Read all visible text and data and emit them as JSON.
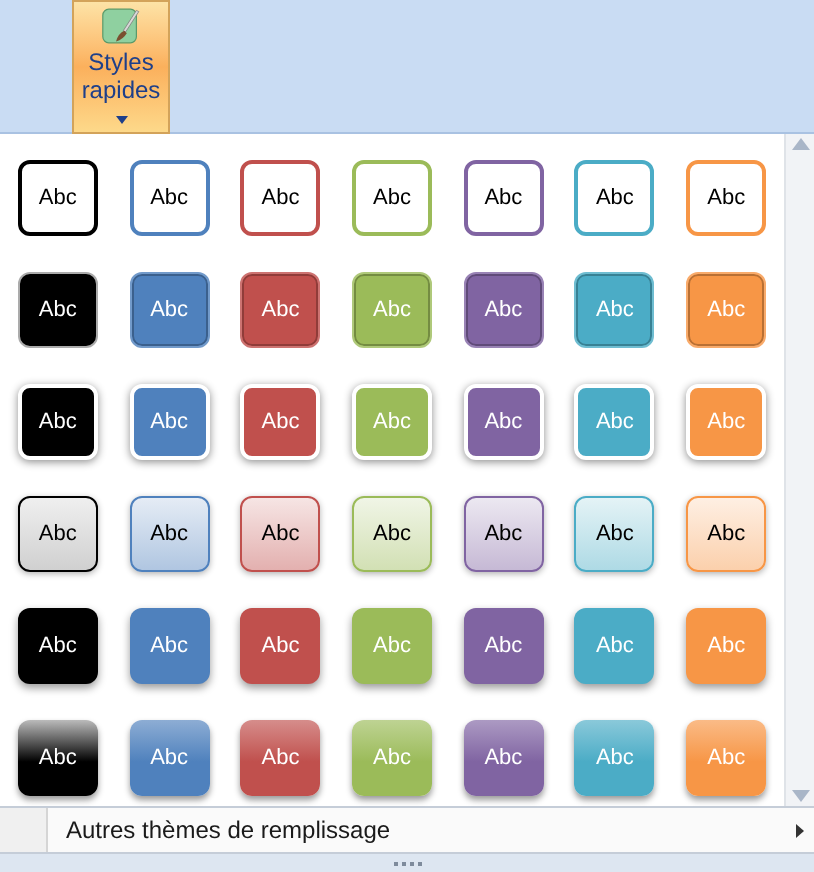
{
  "ribbon_button": {
    "label": "Styles rapides",
    "pressed": true
  },
  "gallery": {
    "rows": [
      {
        "kind": "outline",
        "items": [
          {
            "text": "Abc",
            "color": "#000000"
          },
          {
            "text": "Abc",
            "color": "#4f81bd"
          },
          {
            "text": "Abc",
            "color": "#c0504d"
          },
          {
            "text": "Abc",
            "color": "#9bbb59"
          },
          {
            "text": "Abc",
            "color": "#8064a2"
          },
          {
            "text": "Abc",
            "color": "#4bacc6"
          },
          {
            "text": "Abc",
            "color": "#f79646"
          }
        ]
      },
      {
        "kind": "solid",
        "items": [
          {
            "text": "Abc",
            "color": "#000000"
          },
          {
            "text": "Abc",
            "color": "#4f81bd"
          },
          {
            "text": "Abc",
            "color": "#c0504d"
          },
          {
            "text": "Abc",
            "color": "#9bbb59"
          },
          {
            "text": "Abc",
            "color": "#8064a2"
          },
          {
            "text": "Abc",
            "color": "#4bacc6"
          },
          {
            "text": "Abc",
            "color": "#f79646"
          }
        ]
      },
      {
        "kind": "framed",
        "items": [
          {
            "text": "Abc",
            "color": "#000000"
          },
          {
            "text": "Abc",
            "color": "#4f81bd"
          },
          {
            "text": "Abc",
            "color": "#c0504d"
          },
          {
            "text": "Abc",
            "color": "#9bbb59"
          },
          {
            "text": "Abc",
            "color": "#8064a2"
          },
          {
            "text": "Abc",
            "color": "#4bacc6"
          },
          {
            "text": "Abc",
            "color": "#f79646"
          }
        ]
      },
      {
        "kind": "pale",
        "items": [
          {
            "text": "Abc",
            "color": "#000000"
          },
          {
            "text": "Abc",
            "color": "#4f81bd"
          },
          {
            "text": "Abc",
            "color": "#c0504d"
          },
          {
            "text": "Abc",
            "color": "#9bbb59"
          },
          {
            "text": "Abc",
            "color": "#8064a2"
          },
          {
            "text": "Abc",
            "color": "#4bacc6"
          },
          {
            "text": "Abc",
            "color": "#f79646"
          }
        ]
      },
      {
        "kind": "intense",
        "items": [
          {
            "text": "Abc",
            "color": "#000000"
          },
          {
            "text": "Abc",
            "color": "#4f81bd"
          },
          {
            "text": "Abc",
            "color": "#c0504d"
          },
          {
            "text": "Abc",
            "color": "#9bbb59"
          },
          {
            "text": "Abc",
            "color": "#8064a2"
          },
          {
            "text": "Abc",
            "color": "#4bacc6"
          },
          {
            "text": "Abc",
            "color": "#f79646"
          }
        ]
      },
      {
        "kind": "glossy",
        "items": [
          {
            "text": "Abc",
            "color": "#000000"
          },
          {
            "text": "Abc",
            "color": "#4f81bd"
          },
          {
            "text": "Abc",
            "color": "#c0504d"
          },
          {
            "text": "Abc",
            "color": "#9bbb59"
          },
          {
            "text": "Abc",
            "color": "#8064a2"
          },
          {
            "text": "Abc",
            "color": "#4bacc6"
          },
          {
            "text": "Abc",
            "color": "#f79646"
          }
        ]
      }
    ]
  },
  "menu_item": {
    "label": "Autres thèmes de remplissage"
  }
}
